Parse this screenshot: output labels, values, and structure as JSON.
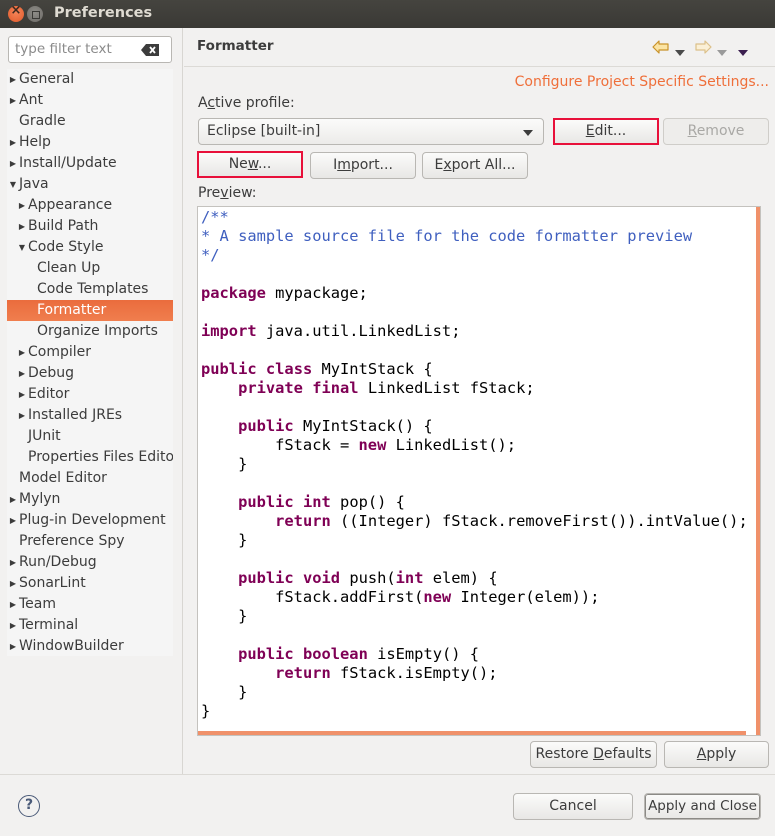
{
  "window": {
    "title": "Preferences"
  },
  "filter": {
    "placeholder": "type filter text"
  },
  "tree": [
    {
      "label": "General",
      "depth": 0,
      "twisty": "collapsed"
    },
    {
      "label": "Ant",
      "depth": 0,
      "twisty": "collapsed"
    },
    {
      "label": "Gradle",
      "depth": 0,
      "twisty": "none"
    },
    {
      "label": "Help",
      "depth": 0,
      "twisty": "collapsed"
    },
    {
      "label": "Install/Update",
      "depth": 0,
      "twisty": "collapsed"
    },
    {
      "label": "Java",
      "depth": 0,
      "twisty": "expanded"
    },
    {
      "label": "Appearance",
      "depth": 1,
      "twisty": "collapsed"
    },
    {
      "label": "Build Path",
      "depth": 1,
      "twisty": "collapsed"
    },
    {
      "label": "Code Style",
      "depth": 1,
      "twisty": "expanded"
    },
    {
      "label": "Clean Up",
      "depth": 2,
      "twisty": "none"
    },
    {
      "label": "Code Templates",
      "depth": 2,
      "twisty": "none"
    },
    {
      "label": "Formatter",
      "depth": 2,
      "twisty": "none",
      "selected": true
    },
    {
      "label": "Organize Imports",
      "depth": 2,
      "twisty": "none"
    },
    {
      "label": "Compiler",
      "depth": 1,
      "twisty": "collapsed"
    },
    {
      "label": "Debug",
      "depth": 1,
      "twisty": "collapsed"
    },
    {
      "label": "Editor",
      "depth": 1,
      "twisty": "collapsed"
    },
    {
      "label": "Installed JREs",
      "depth": 1,
      "twisty": "collapsed"
    },
    {
      "label": "JUnit",
      "depth": 1,
      "twisty": "none"
    },
    {
      "label": "Properties Files Edito",
      "depth": 1,
      "twisty": "none"
    },
    {
      "label": "Model Editor",
      "depth": 0,
      "twisty": "none"
    },
    {
      "label": "Mylyn",
      "depth": 0,
      "twisty": "collapsed"
    },
    {
      "label": "Plug-in Development",
      "depth": 0,
      "twisty": "collapsed"
    },
    {
      "label": "Preference Spy",
      "depth": 0,
      "twisty": "none"
    },
    {
      "label": "Run/Debug",
      "depth": 0,
      "twisty": "collapsed"
    },
    {
      "label": "SonarLint",
      "depth": 0,
      "twisty": "collapsed"
    },
    {
      "label": "Team",
      "depth": 0,
      "twisty": "collapsed"
    },
    {
      "label": "Terminal",
      "depth": 0,
      "twisty": "collapsed"
    },
    {
      "label": "WindowBuilder",
      "depth": 0,
      "twisty": "collapsed"
    }
  ],
  "page": {
    "title": "Formatter",
    "config_link": "Configure Project Specific Settings...",
    "active_profile_label_pre": "A",
    "active_profile_label_ul": "c",
    "active_profile_label_post": "tive profile:",
    "profile_value": "Eclipse [built-in]",
    "preview_label_pre": "Pre",
    "preview_label_ul": "v",
    "preview_label_post": "iew:"
  },
  "buttons": {
    "edit": {
      "ul": "E",
      "rest": "dit..."
    },
    "remove": {
      "ul": "R",
      "rest": "emove"
    },
    "new": {
      "pre": "Ne",
      "ul": "w",
      "rest": "..."
    },
    "import": {
      "pre": "I",
      "ul": "m",
      "rest": "port..."
    },
    "export": {
      "pre": "E",
      "ul": "x",
      "rest": "port All..."
    },
    "restore": {
      "pre": "Restore ",
      "ul": "D",
      "rest": "efaults"
    },
    "apply": {
      "ul": "A",
      "rest": "pply"
    },
    "cancel": "Cancel",
    "apply_close": "Apply and Close"
  },
  "code_lines": [
    [
      {
        "t": "/**",
        "c": "cm"
      }
    ],
    [
      {
        "t": "* A sample source file for the code formatter preview",
        "c": "cm"
      }
    ],
    [
      {
        "t": "*/",
        "c": "cm"
      }
    ],
    [],
    [
      {
        "t": "package",
        "c": "kw"
      },
      {
        "t": " mypackage;"
      }
    ],
    [],
    [
      {
        "t": "import",
        "c": "kw"
      },
      {
        "t": " java.util.LinkedList;"
      }
    ],
    [],
    [
      {
        "t": "public",
        "c": "kw"
      },
      {
        "t": " "
      },
      {
        "t": "class",
        "c": "kw"
      },
      {
        "t": " MyIntStack {"
      }
    ],
    [
      {
        "t": "    "
      },
      {
        "t": "private",
        "c": "kw"
      },
      {
        "t": " "
      },
      {
        "t": "final",
        "c": "kw"
      },
      {
        "t": " LinkedList fStack;"
      }
    ],
    [],
    [
      {
        "t": "    "
      },
      {
        "t": "public",
        "c": "kw"
      },
      {
        "t": " MyIntStack() {"
      }
    ],
    [
      {
        "t": "        fStack = "
      },
      {
        "t": "new",
        "c": "kw"
      },
      {
        "t": " LinkedList();"
      }
    ],
    [
      {
        "t": "    }"
      }
    ],
    [],
    [
      {
        "t": "    "
      },
      {
        "t": "public",
        "c": "kw"
      },
      {
        "t": " "
      },
      {
        "t": "int",
        "c": "kw"
      },
      {
        "t": " pop() {"
      }
    ],
    [
      {
        "t": "        "
      },
      {
        "t": "return",
        "c": "kw"
      },
      {
        "t": " ((Integer) fStack.removeFirst()).intValue();"
      }
    ],
    [
      {
        "t": "    }"
      }
    ],
    [],
    [
      {
        "t": "    "
      },
      {
        "t": "public",
        "c": "kw"
      },
      {
        "t": " "
      },
      {
        "t": "void",
        "c": "kw"
      },
      {
        "t": " push("
      },
      {
        "t": "int",
        "c": "kw"
      },
      {
        "t": " elem) {"
      }
    ],
    [
      {
        "t": "        fStack.addFirst("
      },
      {
        "t": "new",
        "c": "kw"
      },
      {
        "t": " Integer(elem));"
      }
    ],
    [
      {
        "t": "    }"
      }
    ],
    [],
    [
      {
        "t": "    "
      },
      {
        "t": "public",
        "c": "kw"
      },
      {
        "t": " "
      },
      {
        "t": "boolean",
        "c": "kw"
      },
      {
        "t": " isEmpty() {"
      }
    ],
    [
      {
        "t": "        "
      },
      {
        "t": "return",
        "c": "kw"
      },
      {
        "t": " fStack.isEmpty();"
      }
    ],
    [
      {
        "t": "    }"
      }
    ],
    [
      {
        "t": "}"
      }
    ]
  ],
  "icons": {
    "back": "back-arrow-icon",
    "forward": "forward-arrow-icon",
    "menu": "view-menu-icon",
    "help": "?"
  },
  "colors": {
    "accent": "#ef6f3a",
    "selection": "#ea6c3d",
    "highlight_box": "#e8103a",
    "keyword": "#7f0055",
    "comment": "#3f5fbf"
  }
}
